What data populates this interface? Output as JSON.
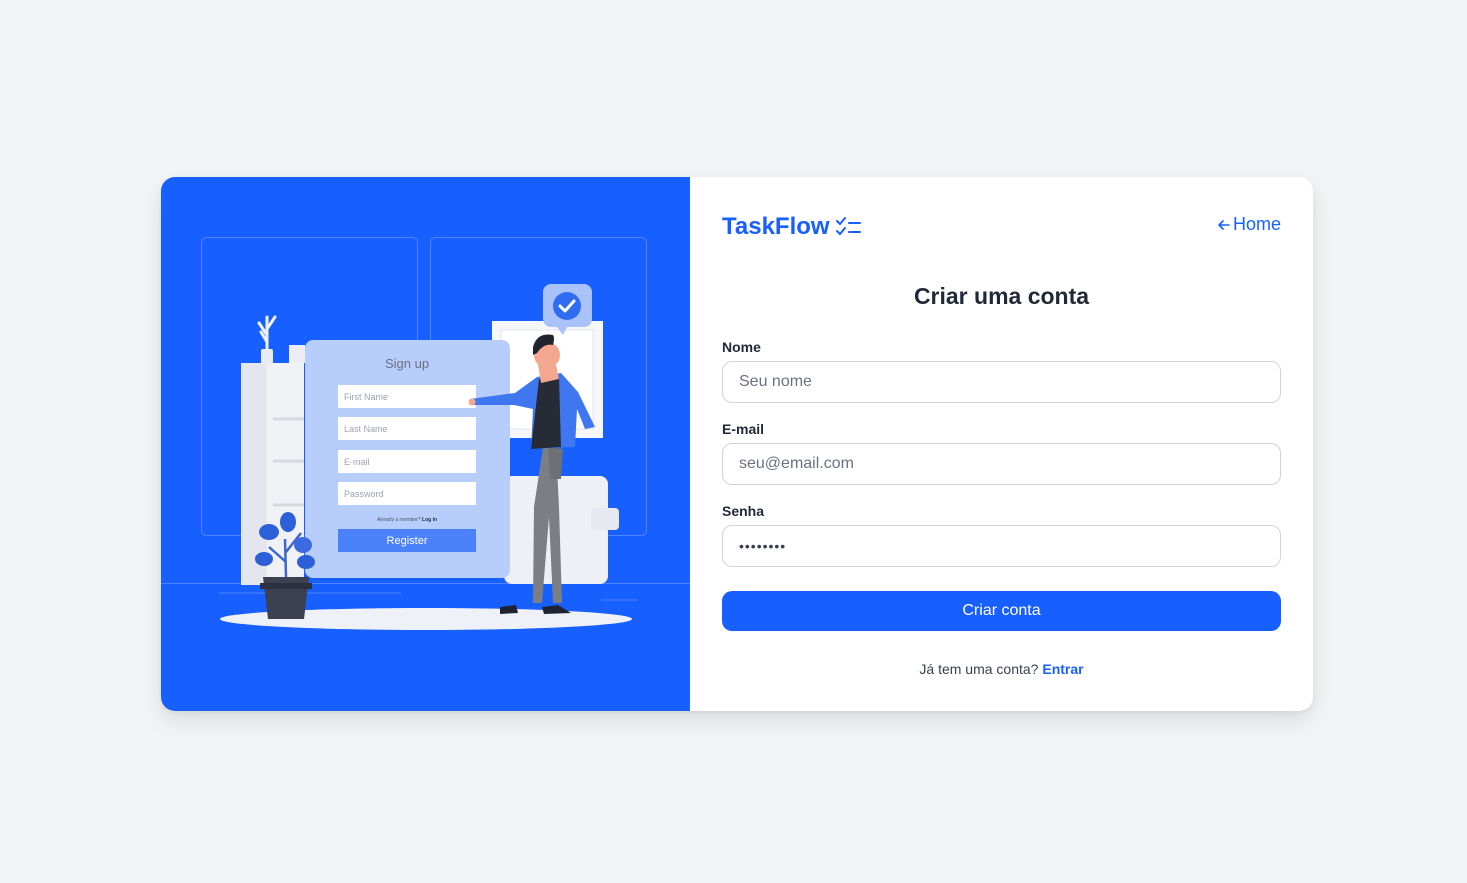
{
  "brand": {
    "name": "TaskFlow",
    "icon": "checklist-icon"
  },
  "nav": {
    "home_label": "Home",
    "back_icon": "arrow-left-icon"
  },
  "form": {
    "title": "Criar uma conta",
    "name_label": "Nome",
    "name_placeholder": "Seu nome",
    "email_label": "E-mail",
    "email_placeholder": "seu@email.com",
    "password_label": "Senha",
    "password_value": "••••••••",
    "submit_label": "Criar conta",
    "login_prompt": "Já tem uma conta?",
    "login_link": "Entrar"
  },
  "illustration": {
    "form_title": "Sign up",
    "fields": [
      "First Name",
      "Last Name",
      "E-mail",
      "Password"
    ],
    "already_member": "Already a member?",
    "login_link": "Log in",
    "button_label": "Register"
  },
  "colors": {
    "accent": "#175ffe",
    "page_bg": "#f3f4f6",
    "heading": "#1f2937"
  }
}
